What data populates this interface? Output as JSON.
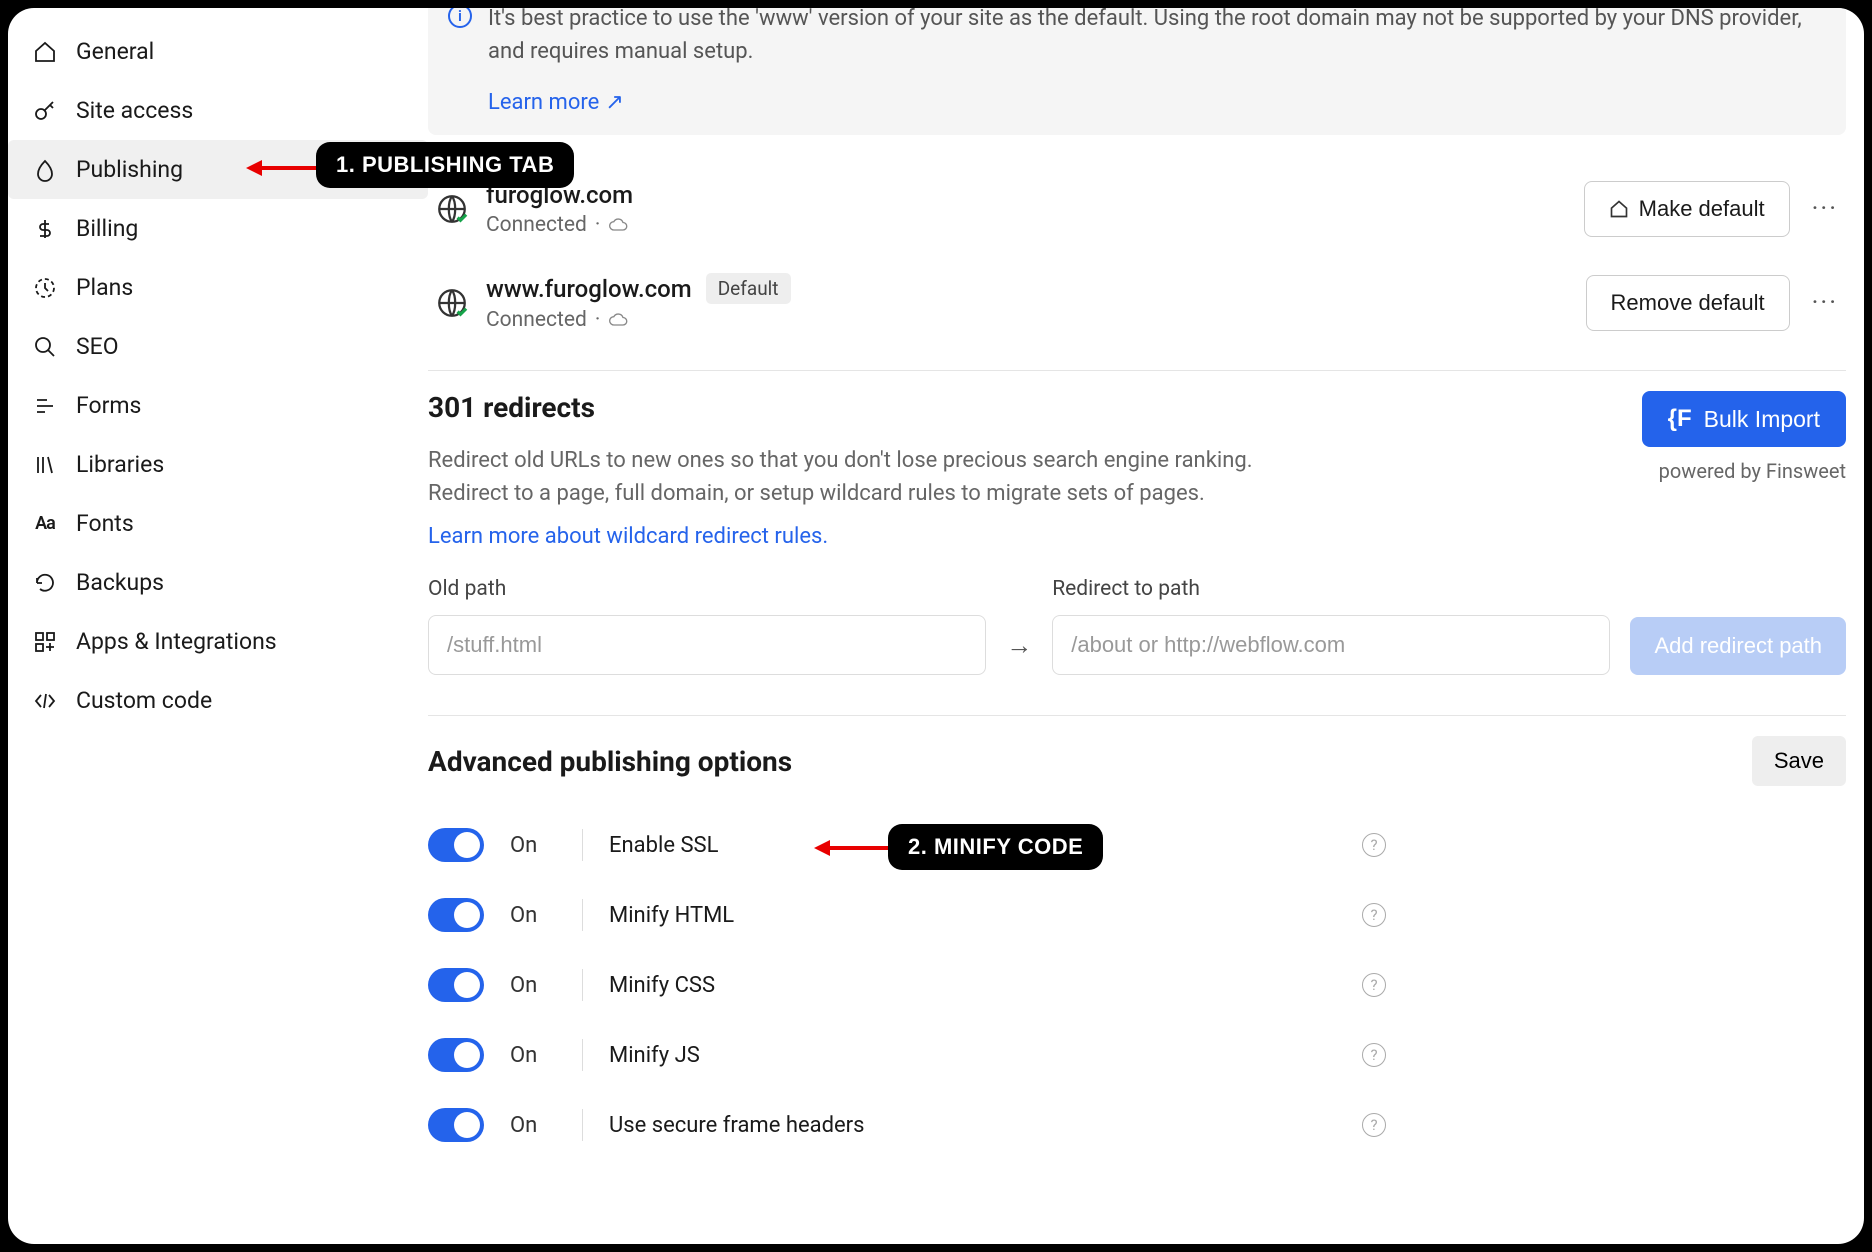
{
  "sidebar": {
    "items": [
      {
        "label": "General",
        "icon": "home"
      },
      {
        "label": "Site access",
        "icon": "key"
      },
      {
        "label": "Publishing",
        "icon": "publish",
        "active": true
      },
      {
        "label": "Billing",
        "icon": "dollar"
      },
      {
        "label": "Plans",
        "icon": "plans"
      },
      {
        "label": "SEO",
        "icon": "search"
      },
      {
        "label": "Forms",
        "icon": "forms"
      },
      {
        "label": "Libraries",
        "icon": "libs"
      },
      {
        "label": "Fonts",
        "icon": "fonts"
      },
      {
        "label": "Backups",
        "icon": "backup"
      },
      {
        "label": "Apps & Integrations",
        "icon": "apps"
      },
      {
        "label": "Custom code",
        "icon": "code"
      }
    ]
  },
  "infobox": {
    "text": "It's best practice to use the 'www' version of your site as the default. Using the root domain may not be supported by your DNS provider, and requires manual setup.",
    "learn_more": "Learn more"
  },
  "domains": [
    {
      "name": "furoglow.com",
      "status": "Connected",
      "default": false,
      "action": "Make default"
    },
    {
      "name": "www.furoglow.com",
      "status": "Connected",
      "default": true,
      "action": "Remove default"
    }
  ],
  "default_badge": "Default",
  "redirects": {
    "title": "301 redirects",
    "desc1": "Redirect old URLs to new ones so that you don't lose precious search engine ranking.",
    "desc2": "Redirect to a page, full domain, or setup wildcard rules to migrate sets of pages.",
    "learn_link": "Learn more about wildcard redirect rules.",
    "bulk_label": "Bulk Import",
    "powered": "powered by Finsweet",
    "old_label": "Old path",
    "old_placeholder": "/stuff.html",
    "new_label": "Redirect to path",
    "new_placeholder": "/about or http://webflow.com",
    "add_btn": "Add redirect path"
  },
  "advanced": {
    "title": "Advanced publishing options",
    "save": "Save",
    "on_label": "On",
    "options": [
      {
        "label": "Enable SSL",
        "on": true
      },
      {
        "label": "Minify HTML",
        "on": true
      },
      {
        "label": "Minify CSS",
        "on": true
      },
      {
        "label": "Minify JS",
        "on": true
      },
      {
        "label": "Use secure frame headers",
        "on": true
      }
    ]
  },
  "annotations": {
    "a1": "1. PUBLISHING TAB",
    "a2": "2. MINIFY CODE"
  }
}
